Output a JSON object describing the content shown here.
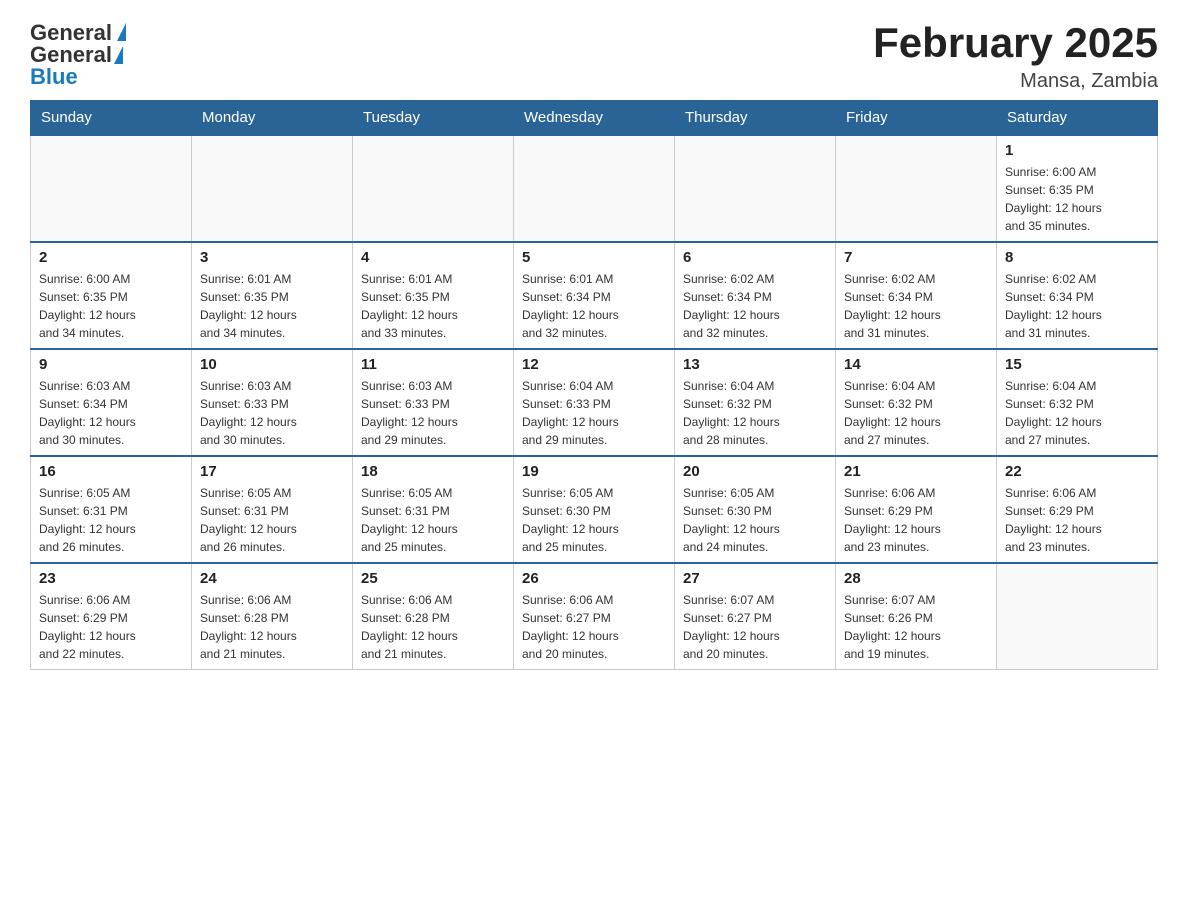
{
  "header": {
    "logo_general": "General",
    "logo_blue": "Blue",
    "title": "February 2025",
    "location": "Mansa, Zambia"
  },
  "weekdays": [
    "Sunday",
    "Monday",
    "Tuesday",
    "Wednesday",
    "Thursday",
    "Friday",
    "Saturday"
  ],
  "weeks": [
    [
      {
        "day": "",
        "info": ""
      },
      {
        "day": "",
        "info": ""
      },
      {
        "day": "",
        "info": ""
      },
      {
        "day": "",
        "info": ""
      },
      {
        "day": "",
        "info": ""
      },
      {
        "day": "",
        "info": ""
      },
      {
        "day": "1",
        "info": "Sunrise: 6:00 AM\nSunset: 6:35 PM\nDaylight: 12 hours\nand 35 minutes."
      }
    ],
    [
      {
        "day": "2",
        "info": "Sunrise: 6:00 AM\nSunset: 6:35 PM\nDaylight: 12 hours\nand 34 minutes."
      },
      {
        "day": "3",
        "info": "Sunrise: 6:01 AM\nSunset: 6:35 PM\nDaylight: 12 hours\nand 34 minutes."
      },
      {
        "day": "4",
        "info": "Sunrise: 6:01 AM\nSunset: 6:35 PM\nDaylight: 12 hours\nand 33 minutes."
      },
      {
        "day": "5",
        "info": "Sunrise: 6:01 AM\nSunset: 6:34 PM\nDaylight: 12 hours\nand 32 minutes."
      },
      {
        "day": "6",
        "info": "Sunrise: 6:02 AM\nSunset: 6:34 PM\nDaylight: 12 hours\nand 32 minutes."
      },
      {
        "day": "7",
        "info": "Sunrise: 6:02 AM\nSunset: 6:34 PM\nDaylight: 12 hours\nand 31 minutes."
      },
      {
        "day": "8",
        "info": "Sunrise: 6:02 AM\nSunset: 6:34 PM\nDaylight: 12 hours\nand 31 minutes."
      }
    ],
    [
      {
        "day": "9",
        "info": "Sunrise: 6:03 AM\nSunset: 6:34 PM\nDaylight: 12 hours\nand 30 minutes."
      },
      {
        "day": "10",
        "info": "Sunrise: 6:03 AM\nSunset: 6:33 PM\nDaylight: 12 hours\nand 30 minutes."
      },
      {
        "day": "11",
        "info": "Sunrise: 6:03 AM\nSunset: 6:33 PM\nDaylight: 12 hours\nand 29 minutes."
      },
      {
        "day": "12",
        "info": "Sunrise: 6:04 AM\nSunset: 6:33 PM\nDaylight: 12 hours\nand 29 minutes."
      },
      {
        "day": "13",
        "info": "Sunrise: 6:04 AM\nSunset: 6:32 PM\nDaylight: 12 hours\nand 28 minutes."
      },
      {
        "day": "14",
        "info": "Sunrise: 6:04 AM\nSunset: 6:32 PM\nDaylight: 12 hours\nand 27 minutes."
      },
      {
        "day": "15",
        "info": "Sunrise: 6:04 AM\nSunset: 6:32 PM\nDaylight: 12 hours\nand 27 minutes."
      }
    ],
    [
      {
        "day": "16",
        "info": "Sunrise: 6:05 AM\nSunset: 6:31 PM\nDaylight: 12 hours\nand 26 minutes."
      },
      {
        "day": "17",
        "info": "Sunrise: 6:05 AM\nSunset: 6:31 PM\nDaylight: 12 hours\nand 26 minutes."
      },
      {
        "day": "18",
        "info": "Sunrise: 6:05 AM\nSunset: 6:31 PM\nDaylight: 12 hours\nand 25 minutes."
      },
      {
        "day": "19",
        "info": "Sunrise: 6:05 AM\nSunset: 6:30 PM\nDaylight: 12 hours\nand 25 minutes."
      },
      {
        "day": "20",
        "info": "Sunrise: 6:05 AM\nSunset: 6:30 PM\nDaylight: 12 hours\nand 24 minutes."
      },
      {
        "day": "21",
        "info": "Sunrise: 6:06 AM\nSunset: 6:29 PM\nDaylight: 12 hours\nand 23 minutes."
      },
      {
        "day": "22",
        "info": "Sunrise: 6:06 AM\nSunset: 6:29 PM\nDaylight: 12 hours\nand 23 minutes."
      }
    ],
    [
      {
        "day": "23",
        "info": "Sunrise: 6:06 AM\nSunset: 6:29 PM\nDaylight: 12 hours\nand 22 minutes."
      },
      {
        "day": "24",
        "info": "Sunrise: 6:06 AM\nSunset: 6:28 PM\nDaylight: 12 hours\nand 21 minutes."
      },
      {
        "day": "25",
        "info": "Sunrise: 6:06 AM\nSunset: 6:28 PM\nDaylight: 12 hours\nand 21 minutes."
      },
      {
        "day": "26",
        "info": "Sunrise: 6:06 AM\nSunset: 6:27 PM\nDaylight: 12 hours\nand 20 minutes."
      },
      {
        "day": "27",
        "info": "Sunrise: 6:07 AM\nSunset: 6:27 PM\nDaylight: 12 hours\nand 20 minutes."
      },
      {
        "day": "28",
        "info": "Sunrise: 6:07 AM\nSunset: 6:26 PM\nDaylight: 12 hours\nand 19 minutes."
      },
      {
        "day": "",
        "info": ""
      }
    ]
  ]
}
